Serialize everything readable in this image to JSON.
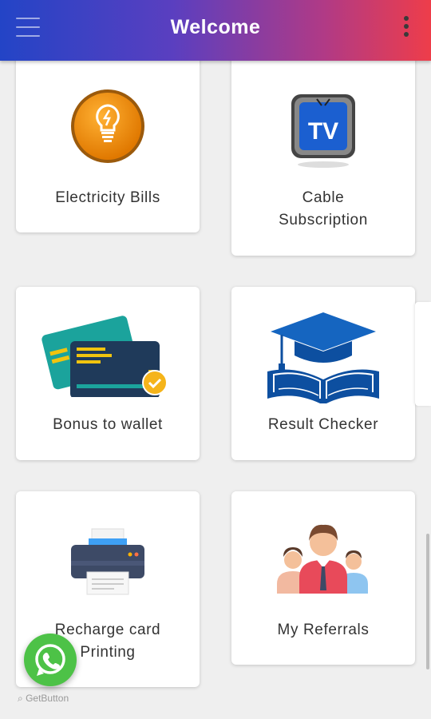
{
  "header": {
    "title": "Welcome"
  },
  "cards": [
    {
      "label": "Electricity Bills",
      "icon": "lightbulb-icon"
    },
    {
      "label": "Cable\nSubscription",
      "icon": "tv-icon"
    },
    {
      "label": "Bonus to wallet",
      "icon": "credit-card-icon"
    },
    {
      "label": "Result Checker",
      "icon": "graduation-cap-icon"
    },
    {
      "label": "Recharge card\nPrinting",
      "icon": "printer-icon"
    },
    {
      "label": "My Referrals",
      "icon": "people-icon"
    }
  ],
  "footer": {
    "getbutton_label": "GetButton"
  },
  "colors": {
    "header_start": "#2344c6",
    "header_end": "#ee3d4a",
    "whatsapp": "#4dc247"
  }
}
